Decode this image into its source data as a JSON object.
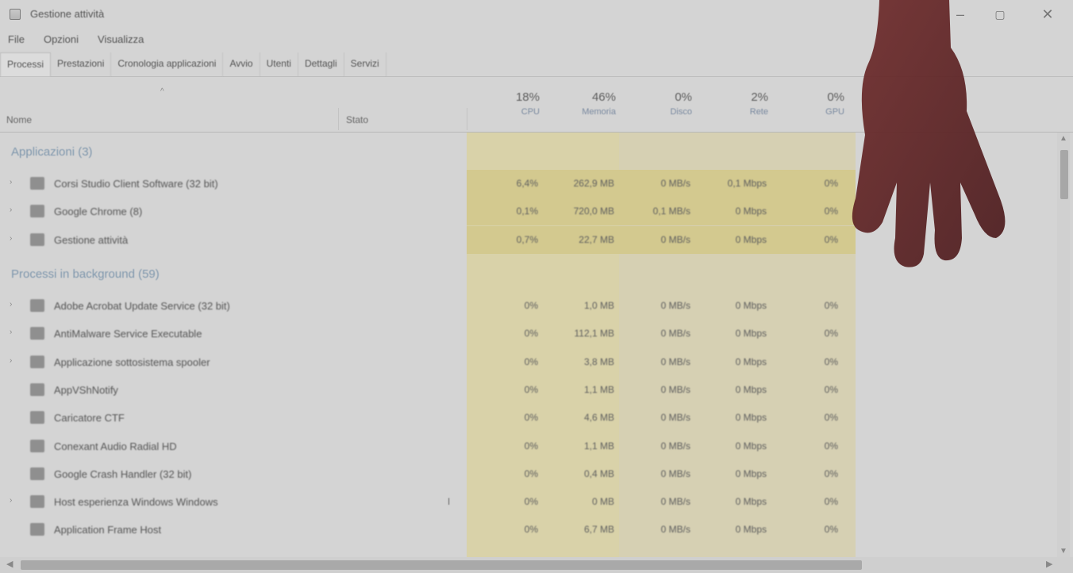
{
  "window": {
    "title": "Gestione attività",
    "controls": {
      "minimize": "–",
      "maximize": "▢",
      "close": "✕"
    }
  },
  "menu": [
    "File",
    "Opzioni",
    "Visualizza"
  ],
  "tabs": [
    {
      "label": "Processi",
      "active": true
    },
    {
      "label": "Prestazioni",
      "active": false
    },
    {
      "label": "Cronologia applicazioni",
      "active": false
    },
    {
      "label": "Avvio",
      "active": false
    },
    {
      "label": "Utenti",
      "active": false
    },
    {
      "label": "Dettagli",
      "active": false
    },
    {
      "label": "Servizi",
      "active": false
    }
  ],
  "columns": {
    "name": "Nome",
    "status": "Stato",
    "metrics": [
      {
        "pct": "18%",
        "label": "CPU"
      },
      {
        "pct": "46%",
        "label": "Memoria"
      },
      {
        "pct": "0%",
        "label": "Disco"
      },
      {
        "pct": "2%",
        "label": "Rete"
      },
      {
        "pct": "0%",
        "label": "GPU"
      }
    ]
  },
  "groups": {
    "apps": "Applicazioni (3)",
    "background": "Processi in background (59)"
  },
  "apps": [
    {
      "name": "Corsi Studio Client Software (32 bit)",
      "status": "",
      "cpu": "6,4%",
      "mem": "262,9 MB",
      "disk": "0 MB/s",
      "net": "0,1 Mbps",
      "gpu": "0%",
      "icon": "app-icon"
    },
    {
      "name": "Google Chrome (8)",
      "status": "",
      "cpu": "0,1%",
      "mem": "720,0 MB",
      "disk": "0,1 MB/s",
      "net": "0 Mbps",
      "gpu": "0%",
      "icon": "chrome-icon"
    },
    {
      "name": "Gestione attività",
      "status": "",
      "cpu": "0,7%",
      "mem": "22,7 MB",
      "disk": "0 MB/s",
      "net": "0 Mbps",
      "gpu": "0%",
      "icon": "taskmgr-icon"
    }
  ],
  "background": [
    {
      "name": "Adobe Acrobat Update Service (32 bit)",
      "status": "",
      "cpu": "0%",
      "mem": "1,0 MB",
      "disk": "0 MB/s",
      "net": "0 Mbps",
      "gpu": "0%",
      "icon": "service-icon",
      "expand": true
    },
    {
      "name": "AntiMalware Service Executable",
      "status": "",
      "cpu": "0%",
      "mem": "112,1 MB",
      "disk": "0 MB/s",
      "net": "0 Mbps",
      "gpu": "0%",
      "icon": "service-icon",
      "expand": true
    },
    {
      "name": "Applicazione sottosistema spooler",
      "status": "",
      "cpu": "0%",
      "mem": "3,8 MB",
      "disk": "0 MB/s",
      "net": "0 Mbps",
      "gpu": "0%",
      "icon": "printer-icon",
      "expand": true
    },
    {
      "name": "AppVShNotify",
      "status": "",
      "cpu": "0%",
      "mem": "1,1 MB",
      "disk": "0 MB/s",
      "net": "0 Mbps",
      "gpu": "0%",
      "icon": "service-icon",
      "expand": false
    },
    {
      "name": "Caricatore CTF",
      "status": "",
      "cpu": "0%",
      "mem": "4,6 MB",
      "disk": "0 MB/s",
      "net": "0 Mbps",
      "gpu": "0%",
      "icon": "pen-icon",
      "expand": false
    },
    {
      "name": "Conexant Audio Radial HD",
      "status": "",
      "cpu": "0%",
      "mem": "1,1 MB",
      "disk": "0 MB/s",
      "net": "0 Mbps",
      "gpu": "0%",
      "icon": "audio-icon",
      "expand": false
    },
    {
      "name": "Google Crash Handler (32 bit)",
      "status": "",
      "cpu": "0%",
      "mem": "0,4 MB",
      "disk": "0 MB/s",
      "net": "0 Mbps",
      "gpu": "0%",
      "icon": "service-icon",
      "expand": false
    },
    {
      "name": "Host esperienza Windows Windows",
      "status": "ǀ",
      "cpu": "0%",
      "mem": "0 MB",
      "disk": "0 MB/s",
      "net": "0 Mbps",
      "gpu": "0%",
      "icon": "window-icon",
      "expand": true
    },
    {
      "name": "Application Frame Host",
      "status": "",
      "cpu": "0%",
      "mem": "6,7 MB",
      "disk": "0 MB/s",
      "net": "0 Mbps",
      "gpu": "0%",
      "icon": "service-icon",
      "expand": false
    }
  ],
  "colors": {
    "heat_high": "#d3c98f",
    "heat_low": "#d9d2a9",
    "group_header": "#7f97ad",
    "background": "#d4d4d4"
  }
}
